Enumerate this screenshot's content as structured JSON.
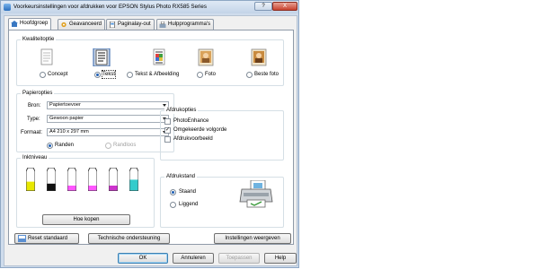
{
  "window": {
    "title": "Voorkeursinstellingen voor afdrukken voor EPSON Stylus Photo RX585 Series",
    "help_label": "?",
    "close_label": "X"
  },
  "tabs": [
    {
      "label": "Hoofdgroep",
      "icon": "home-icon"
    },
    {
      "label": "Geavanceerd",
      "icon": "gear-icon"
    },
    {
      "label": "Paginalay-out",
      "icon": "page-layout-icon"
    },
    {
      "label": "Hulpprogramma's",
      "icon": "utility-icon"
    }
  ],
  "quality": {
    "label": "Kwaliteitoptie",
    "options": [
      {
        "label": "Concept",
        "icon": "draft-document-icon",
        "selected": false
      },
      {
        "label": "Tekst",
        "icon": "text-document-icon",
        "selected": true
      },
      {
        "label": "Tekst & Afbeelding",
        "icon": "text-image-document-icon",
        "selected": false
      },
      {
        "label": "Foto",
        "icon": "photo-icon",
        "selected": false
      },
      {
        "label": "Beste foto",
        "icon": "best-photo-icon",
        "selected": false
      }
    ]
  },
  "paper": {
    "label": "Papieropties",
    "source_label": "Bron:",
    "source_value": "Papiertoevoer",
    "type_label": "Type:",
    "type_value": "Gewoon papier",
    "format_label": "Formaat:",
    "format_value": "A4 210 x 297 mm",
    "margins": "Randen",
    "borderless": "Randloos"
  },
  "print_options": {
    "label": "Afdrukopties",
    "items": [
      {
        "label": "PhotoEnhance",
        "checked": false
      },
      {
        "label": "Omgekeerde volgorde",
        "checked": true
      },
      {
        "label": "Afdrukvoorbeeld",
        "checked": false
      }
    ]
  },
  "ink": {
    "label": "Inktniveau",
    "cartridges": [
      {
        "color": "#e8e800",
        "level": 0.45
      },
      {
        "color": "#111111",
        "level": 0.35
      },
      {
        "color": "#ff55ff",
        "level": 0.25
      },
      {
        "color": "#ff55ff",
        "level": 0.25
      },
      {
        "color": "#cc33cc",
        "level": 0.25
      },
      {
        "color": "#33cccc",
        "level": 0.55
      }
    ],
    "how_to_order": "Hoe kopen"
  },
  "orientation": {
    "label": "Afdrukstand",
    "portrait": "Staand",
    "landscape": "Liggend"
  },
  "bottom_buttons": {
    "reset": "Reset standaard",
    "support": "Technische ondersteuning",
    "show_settings": "Instellingen weergeven"
  },
  "dialog_buttons": {
    "ok": "OK",
    "cancel": "Annuleren",
    "apply": "Toepassen",
    "help": "Help"
  }
}
